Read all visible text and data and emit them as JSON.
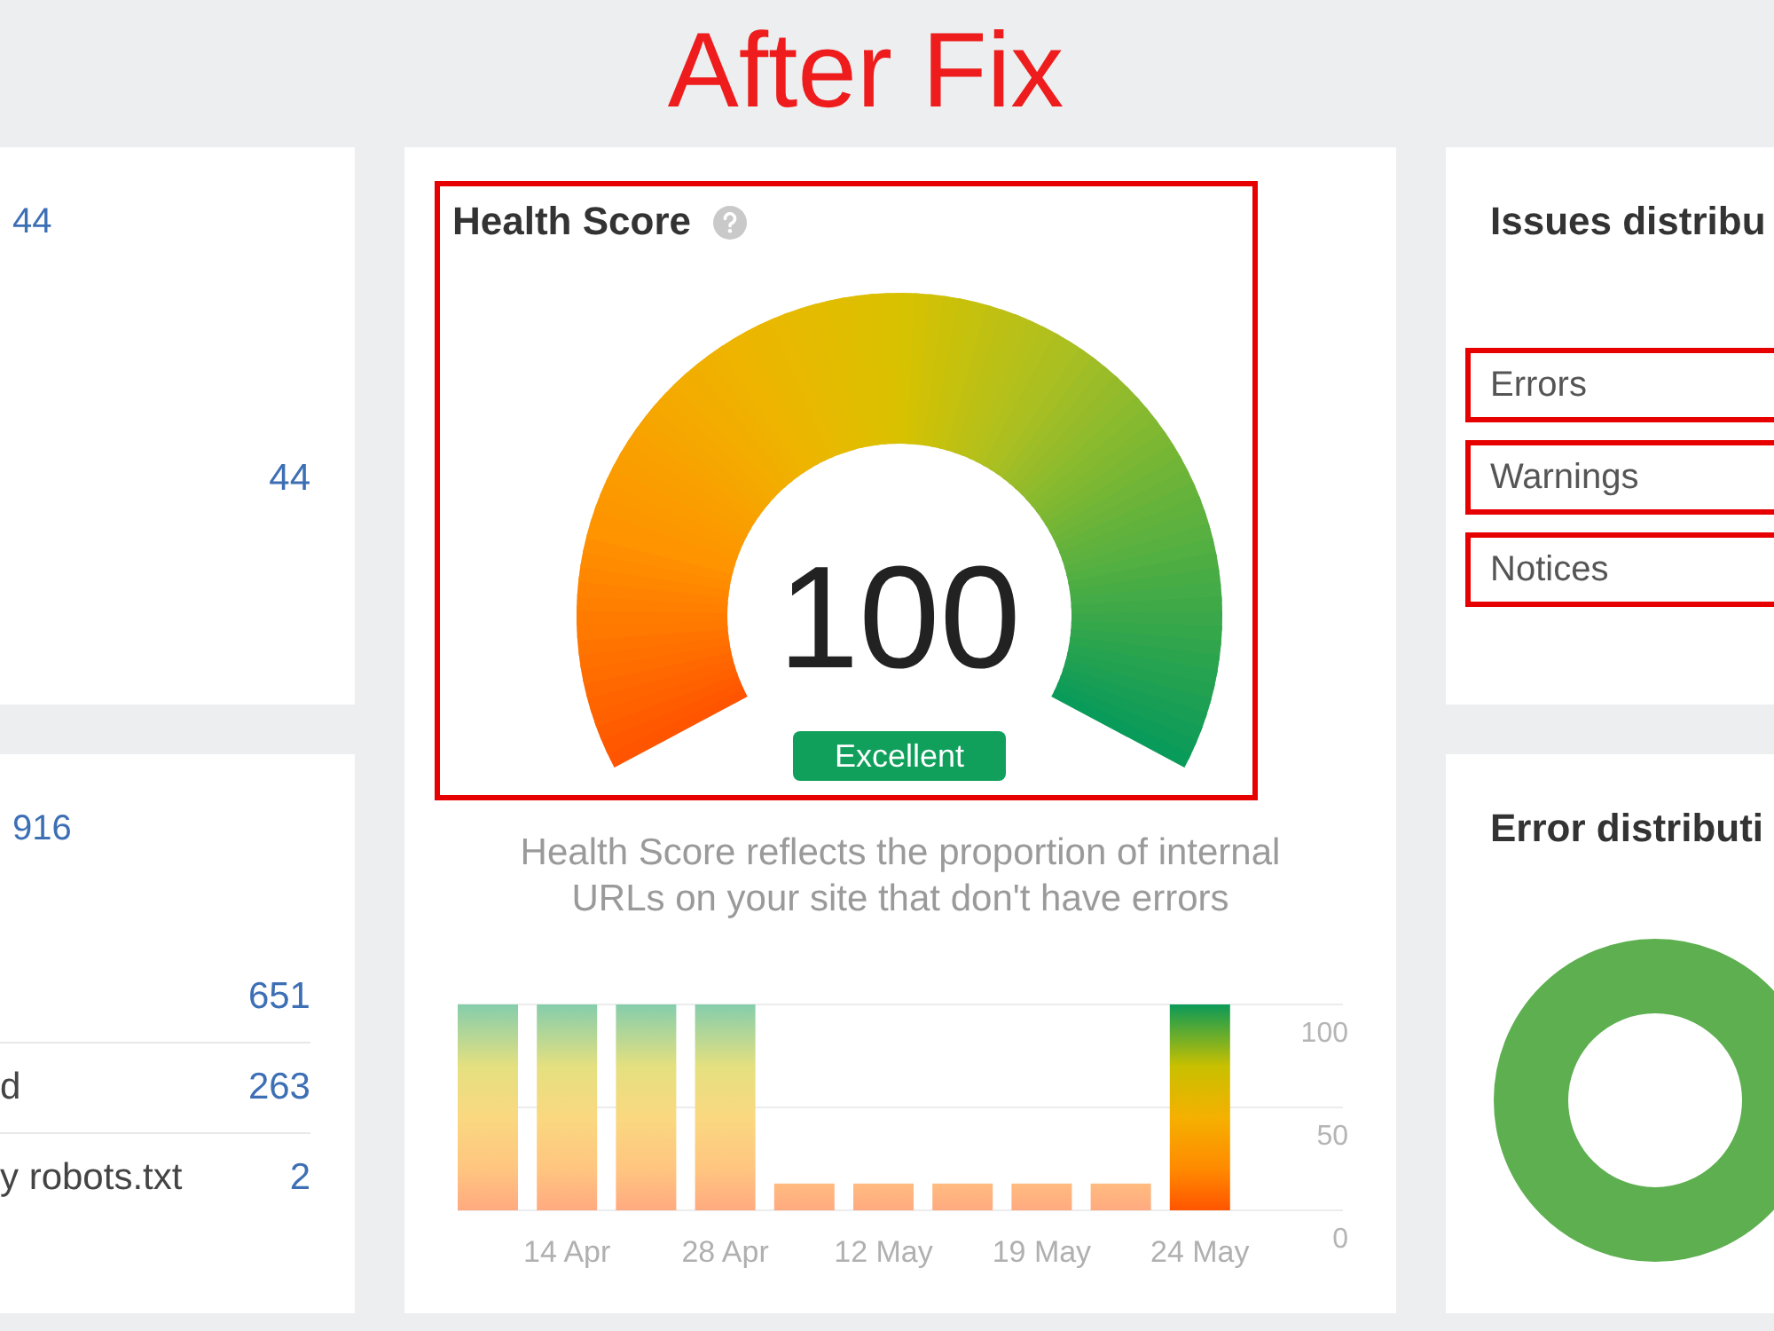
{
  "title": "After Fix",
  "left_panels": [
    {
      "value": "44",
      "rows": [
        {
          "value": "44"
        }
      ]
    },
    {
      "value": "916",
      "rows": [
        {
          "value": "651"
        },
        {
          "label": "d",
          "value": "263"
        },
        {
          "label": "y robots.txt",
          "value": "2"
        }
      ]
    }
  ],
  "health_score": {
    "title": "Health Score",
    "outlined": true,
    "gauge": {
      "level": 1,
      "score": "100",
      "rating": "Excellent"
    },
    "description": "Health Score reflects the proportion of internal URLs on your site that don't have errors",
    "chart_data": [
      {
        "type": "bar",
        "categories": [
          null,
          "14 Apr",
          null,
          "28 Apr",
          null,
          "12 May",
          null,
          "19 May",
          null,
          "24 May"
        ],
        "series": [
          {
            "values": [
              100,
              100,
              100,
              100,
              13,
              13,
              13,
              13,
              13,
              null
            ]
          },
          {
            "values": [
              null,
              null,
              null,
              null,
              null,
              null,
              null,
              null,
              null,
              100
            ]
          }
        ],
        "yticks": [
          0,
          50,
          100
        ],
        "ylim": [
          0,
          100
        ],
        "grid": true
      }
    ]
  },
  "issues_distribution": {
    "title": "Issues distribu",
    "items": [
      {
        "label": "Errors",
        "outlined": true
      },
      {
        "label": "Warnings",
        "outlined": true
      },
      {
        "label": "Notices",
        "outlined": true
      }
    ]
  },
  "error_distribution": {
    "title": "Error distributi"
  }
}
